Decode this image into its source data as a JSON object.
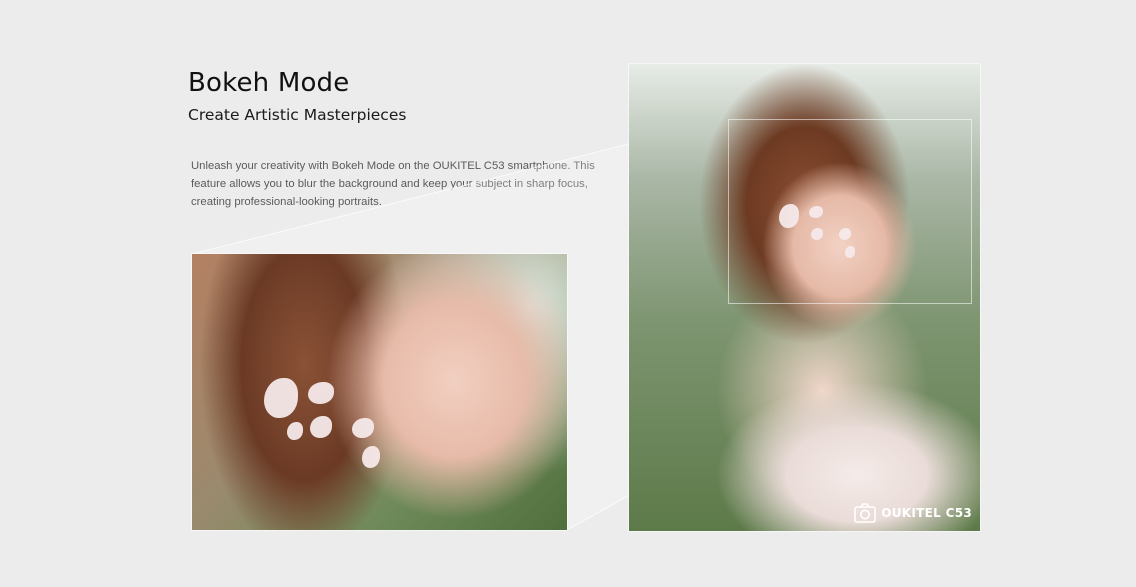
{
  "header": {
    "title": "Bokeh Mode",
    "subtitle": "Create Artistic Masterpieces"
  },
  "body": {
    "description": "Unleash your creativity with Bokeh Mode on the OUKITEL C53 smartphone. This feature allows you to blur the background and keep your subject in sharp focus, creating professional-looking portraits."
  },
  "photos": {
    "watermark_text": "OUKITEL C53",
    "watermark_icon": "camera-icon"
  },
  "colors": {
    "background": "#ececec",
    "title": "#111111",
    "description": "#5b5b5b"
  }
}
